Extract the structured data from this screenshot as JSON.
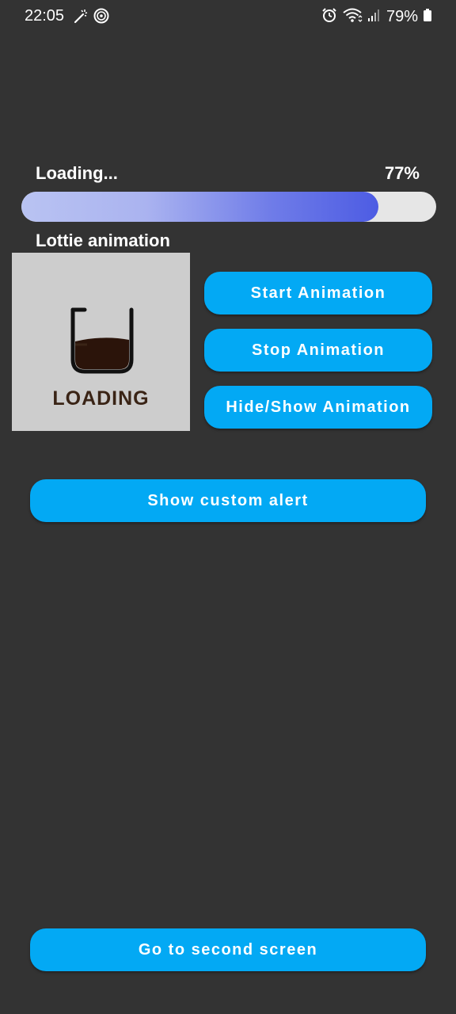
{
  "status_bar": {
    "time": "22:05",
    "battery_text": "79%",
    "left_icons": [
      "magic-wand-icon",
      "focus-mode-icon"
    ],
    "right_icons": [
      "alarm-icon",
      "wifi-icon",
      "signal-icon",
      "battery-icon"
    ]
  },
  "progress": {
    "label": "Loading...",
    "percent_text": "77%",
    "value": 0.86,
    "gradient_start": "#b9c3f2",
    "gradient_end": "#4d5ce3",
    "track_color": "#e6e6e6"
  },
  "lottie": {
    "label": "Lottie animation",
    "animation_text": "LOADING",
    "coffee_color": "#3a2416"
  },
  "buttons": {
    "start": "Start Animation",
    "stop": "Stop Animation",
    "hide_show": "Hide/Show Animation",
    "custom_alert": "Show custom alert",
    "second_screen": "Go to second screen"
  },
  "colors": {
    "background": "#333333",
    "button": "#03a9f4",
    "button_text": "#ffffff"
  }
}
